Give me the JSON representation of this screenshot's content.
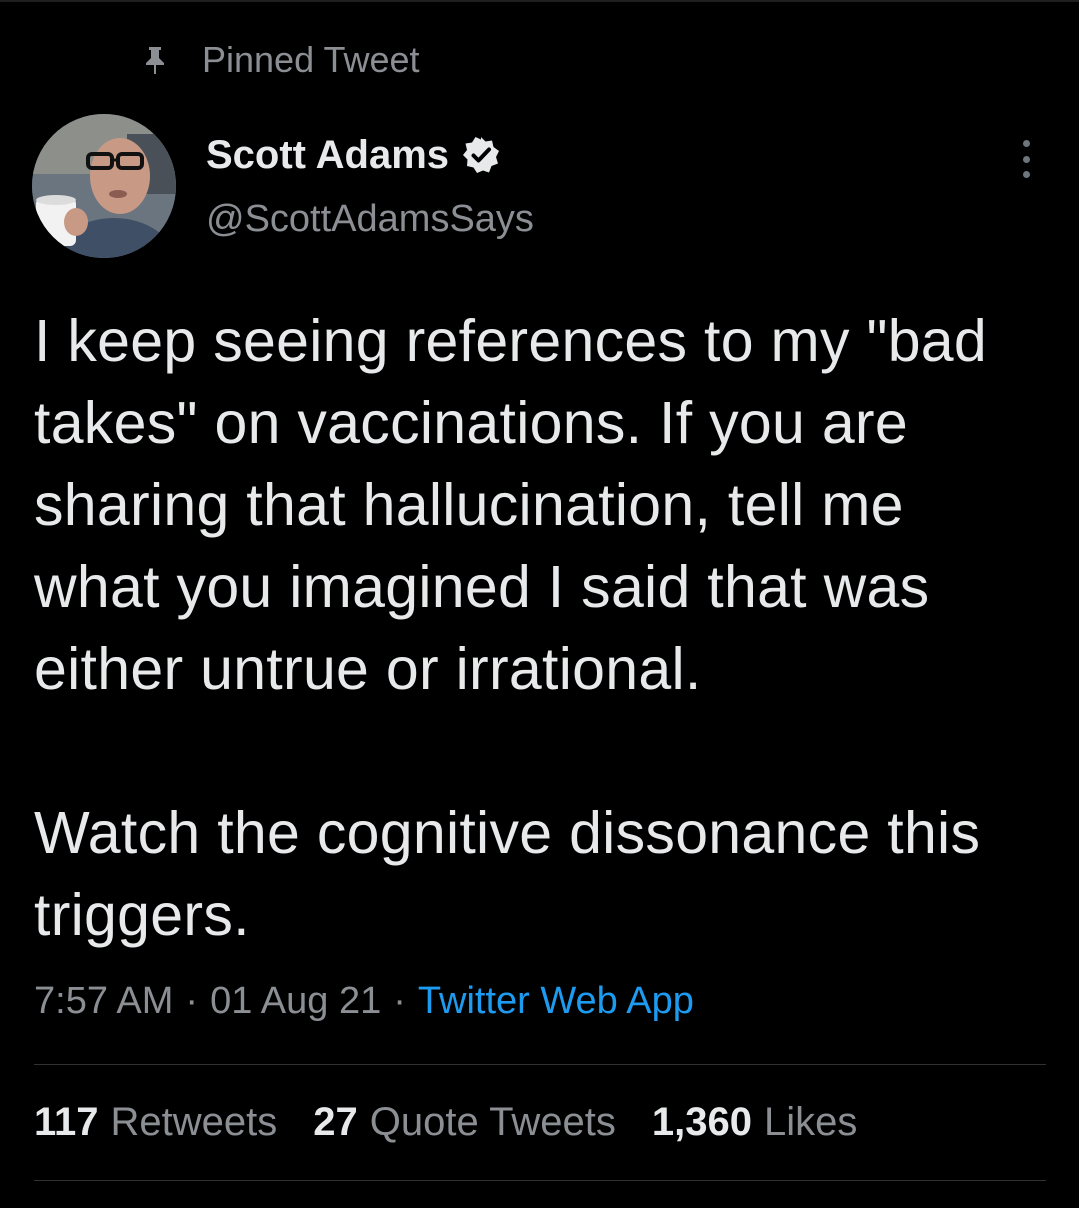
{
  "pinned": {
    "label": "Pinned Tweet",
    "icon": "pin-icon"
  },
  "author": {
    "name": "Scott Adams",
    "handle": "@ScottAdamsSays",
    "verified": true
  },
  "tweet": {
    "paragraphs": [
      "I keep seeing references to my \"bad takes\" on vaccinations. If you are sharing that hallucination, tell me what you imagined I said that was either untrue or irrational.",
      "Watch the cognitive dissonance this triggers."
    ],
    "time": "7:57 AM",
    "date": "01 Aug 21",
    "source": "Twitter Web App",
    "separator": "·"
  },
  "stats": {
    "retweets": {
      "count": "117",
      "label": "Retweets"
    },
    "quotes": {
      "count": "27",
      "label": "Quote Tweets"
    },
    "likes": {
      "count": "1,360",
      "label": "Likes"
    }
  },
  "colors": {
    "background": "#000000",
    "text": "#e7e9ea",
    "secondary": "#8b8f94",
    "link": "#1d9bf0",
    "divider": "#2f3336"
  }
}
